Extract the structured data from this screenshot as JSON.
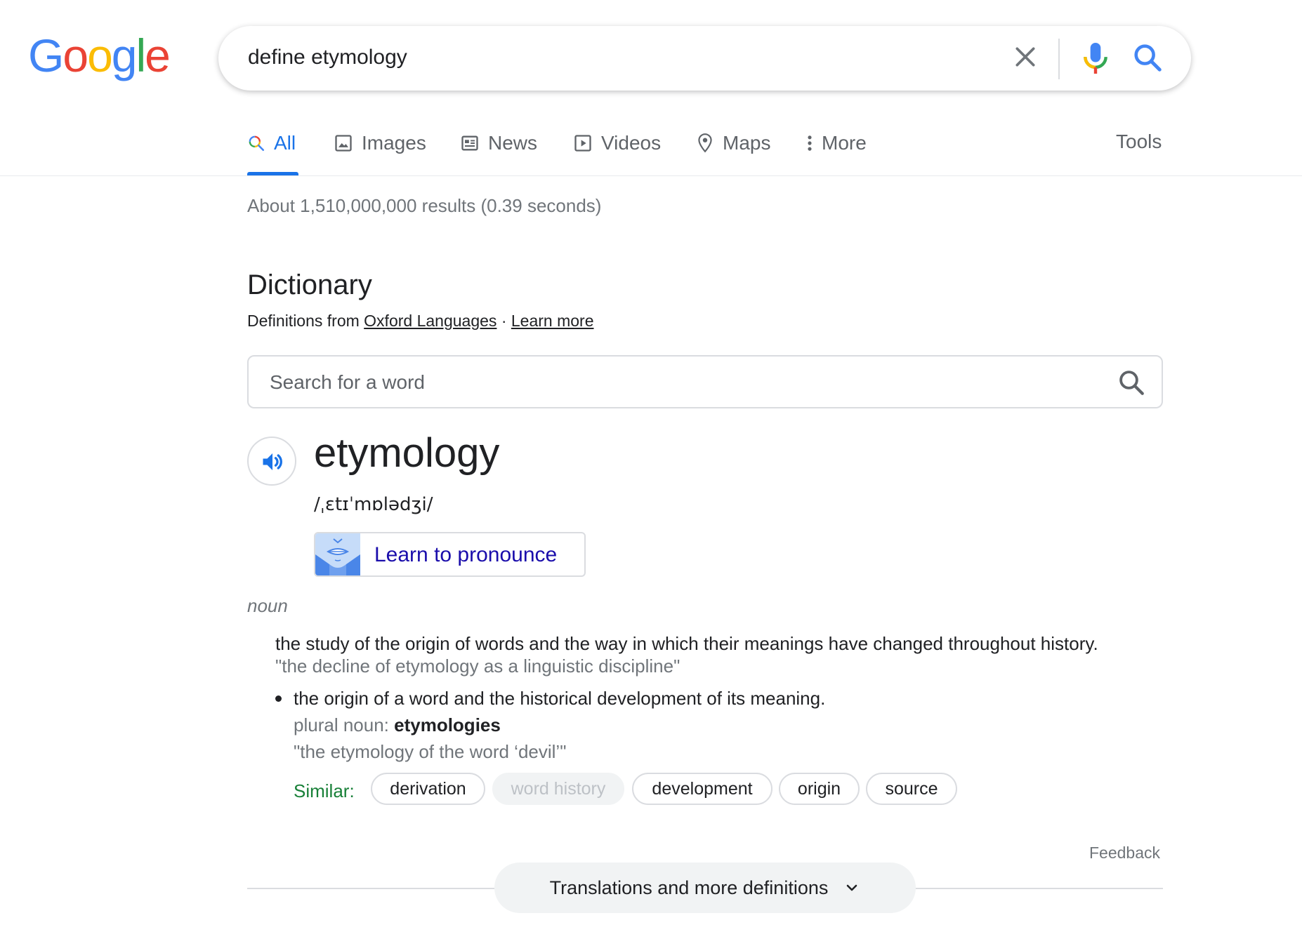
{
  "logo": {
    "letters": [
      "G",
      "o",
      "o",
      "g",
      "l",
      "e"
    ],
    "colors": [
      "#4285F4",
      "#EA4335",
      "#FBBC05",
      "#4285F4",
      "#34A853",
      "#EA4335"
    ]
  },
  "search": {
    "query": "define etymology"
  },
  "tabs": [
    {
      "label": "All",
      "icon": "search-icon"
    },
    {
      "label": "Images",
      "icon": "image-icon"
    },
    {
      "label": "News",
      "icon": "news-icon"
    },
    {
      "label": "Videos",
      "icon": "video-icon"
    },
    {
      "label": "Maps",
      "icon": "map-pin-icon"
    },
    {
      "label": "More",
      "icon": "more-vertical-icon"
    }
  ],
  "tools_label": "Tools",
  "result_stats": "About 1,510,000,000 results (0.39 seconds)",
  "dictionary": {
    "title": "Dictionary",
    "source_prefix": "Definitions from",
    "source_link": "Oxford Languages",
    "separator": "·",
    "learn_more": "Learn more",
    "search_placeholder": "Search for a word",
    "word": "etymology",
    "phonetic": "/ˌɛtɪˈmɒlədʒi/",
    "pronounce_label": "Learn to pronounce",
    "part_of_speech": "noun",
    "definition_1": "the study of the origin of words and the way in which their meanings have changed throughout history.",
    "example_1": "\"the decline of etymology as a linguistic discipline\"",
    "definition_2": "the origin of a word and the historical development of its meaning.",
    "plural_label": "plural noun:",
    "plural_value": "etymologies",
    "example_2": "\"the etymology of the word ‘devil’\"",
    "similar_label": "Similar:",
    "similar": [
      "derivation",
      "word history",
      "development",
      "origin",
      "source"
    ],
    "feedback": "Feedback",
    "more_definitions": "Translations and more definitions"
  },
  "colors": {
    "accent": "#1a73e8",
    "link": "#1a0dab",
    "similar": "#188038",
    "muted": "#70757a"
  }
}
